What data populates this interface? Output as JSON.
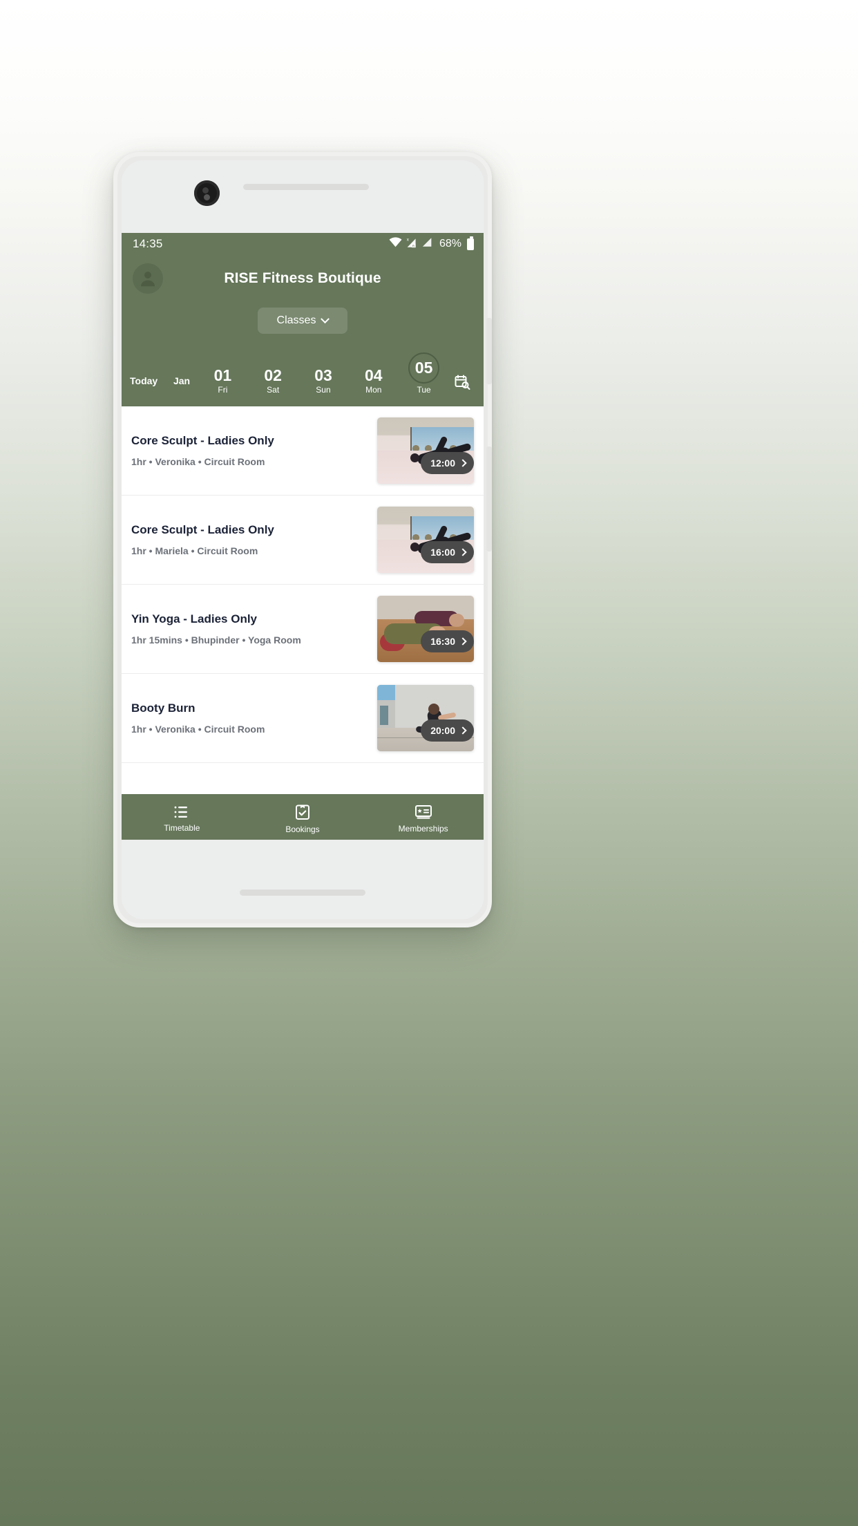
{
  "status_bar": {
    "time": "14:35",
    "battery_percent": "68%",
    "icons": [
      "wifi-icon",
      "signal-x-roaming-icon",
      "signal-icon",
      "battery-icon"
    ]
  },
  "header": {
    "title": "RISE Fitness Boutique",
    "avatar_icon": "user-avatar-icon",
    "dropdown": {
      "label": "Classes",
      "chevron": "chevron-down-icon"
    },
    "accent_color": "#66775a"
  },
  "date_strip": {
    "today_label": "Today",
    "month_label": "Jan",
    "calendar_icon": "calendar-search-icon",
    "days": [
      {
        "num": "01",
        "name": "Fri",
        "selected": false
      },
      {
        "num": "02",
        "name": "Sat",
        "selected": false
      },
      {
        "num": "03",
        "name": "Sun",
        "selected": false
      },
      {
        "num": "04",
        "name": "Mon",
        "selected": false
      },
      {
        "num": "05",
        "name": "Tue",
        "selected": true
      }
    ]
  },
  "classes": [
    {
      "title": "Core Sculpt - Ladies Only",
      "meta": "1hr • Veronika • Circuit Room",
      "time": "12:00",
      "thumb": "pilates-side-plank-photo"
    },
    {
      "title": "Core Sculpt - Ladies Only",
      "meta": "1hr • Mariela • Circuit Room",
      "time": "16:00",
      "thumb": "pilates-side-plank-photo"
    },
    {
      "title": "Yin Yoga - Ladies Only",
      "meta": "1hr 15mins • Bhupinder • Yoga Room",
      "time": "16:30",
      "thumb": "yin-yoga-floor-photo"
    },
    {
      "title": "Booty Burn",
      "meta": "1hr • Veronika • Circuit Room",
      "time": "20:00",
      "thumb": "outdoor-squat-photo"
    }
  ],
  "bottom_nav": [
    {
      "label": "Timetable",
      "icon": "list-bullets-icon",
      "active": true
    },
    {
      "label": "Bookings",
      "icon": "clipboard-check-icon",
      "active": false
    },
    {
      "label": "Memberships",
      "icon": "membership-card-icon",
      "active": false
    }
  ]
}
